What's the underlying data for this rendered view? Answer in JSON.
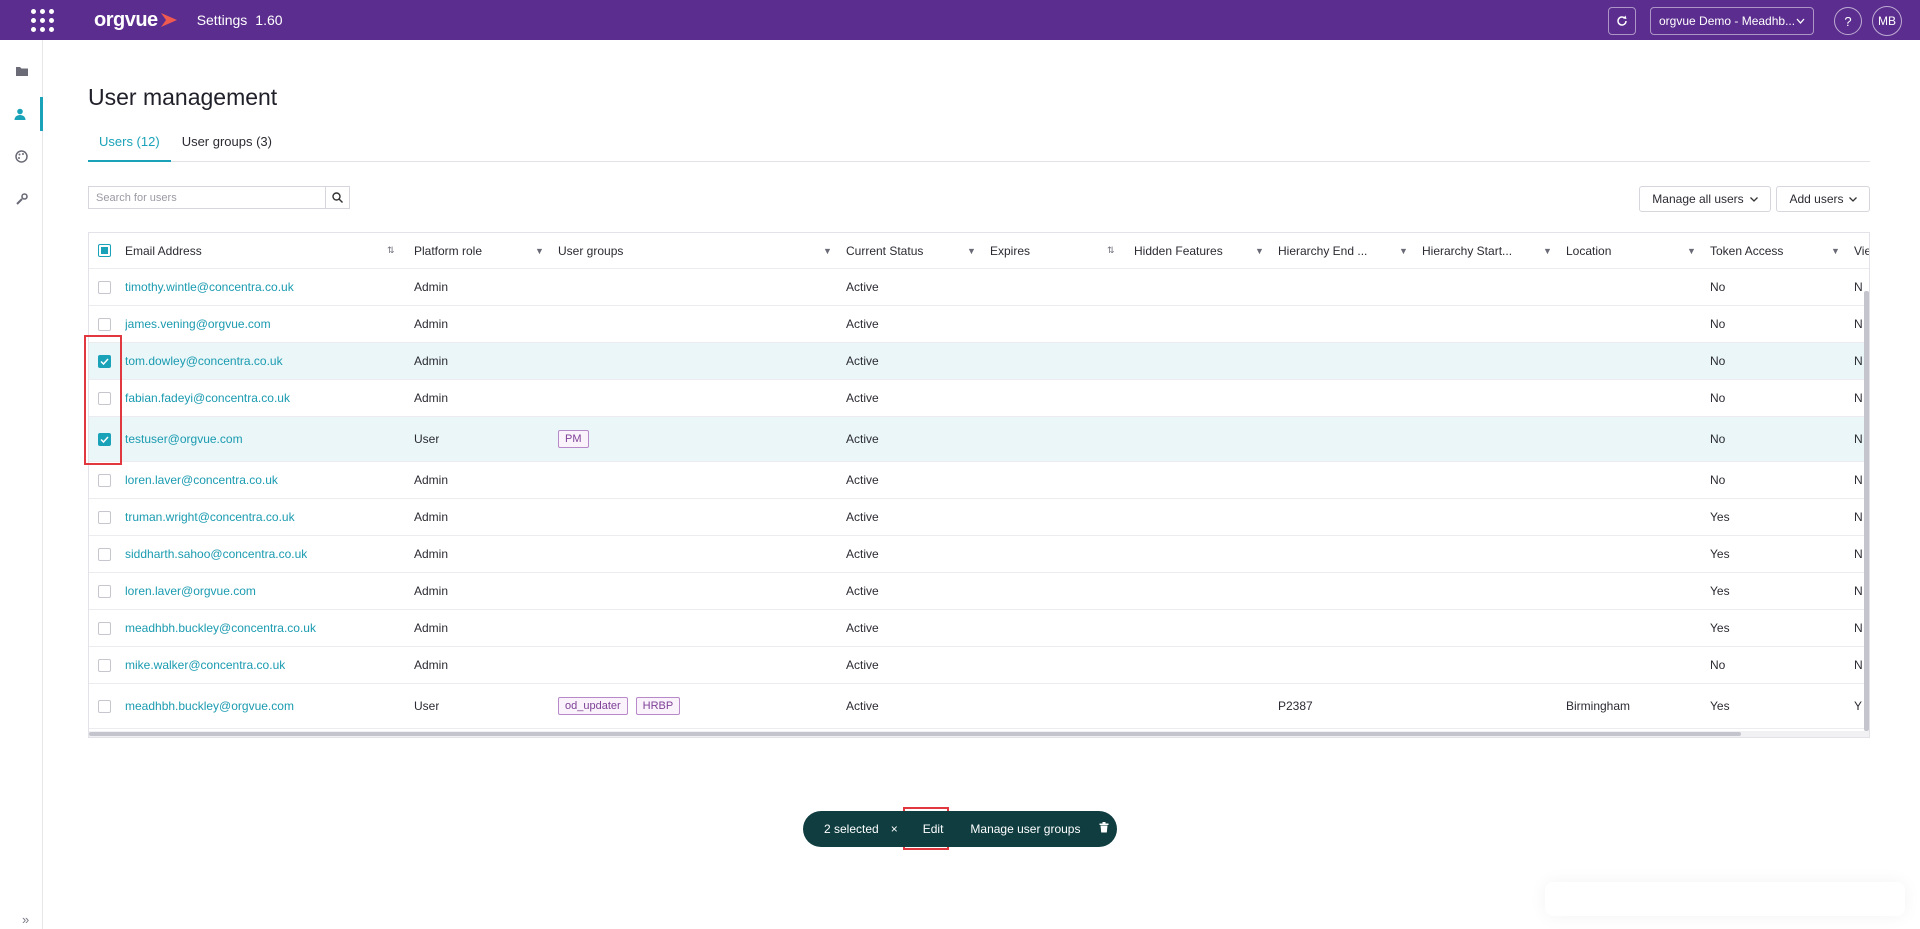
{
  "header": {
    "logo_text": "orgvue",
    "app_title": "Settings",
    "app_version": "1.60",
    "org_select": "orgvue Demo - Meadhb...",
    "help_label": "?",
    "avatar_initials": "MB",
    "brand_color": "#5b2d8e",
    "logo_accent": "#f05a4f"
  },
  "sidebar": {
    "items": [
      {
        "icon": "folder-icon"
      },
      {
        "icon": "user-icon",
        "active": true
      },
      {
        "icon": "palette-icon"
      },
      {
        "icon": "wrench-icon"
      }
    ],
    "expand_label": "»"
  },
  "page": {
    "title": "User management",
    "tabs": [
      {
        "label": "Users (12)",
        "active": true
      },
      {
        "label": "User groups (3)",
        "active": false
      }
    ],
    "search": {
      "placeholder": "Search for users",
      "value": ""
    },
    "manage_all_label": "Manage all users",
    "add_users_label": "Add users"
  },
  "table": {
    "columns": [
      "Email Address",
      "Platform role",
      "User groups",
      "Current Status",
      "Expires",
      "Hidden Features",
      "Hierarchy End ...",
      "Hierarchy Start...",
      "Location",
      "Token Access",
      "Vie"
    ],
    "rows": [
      {
        "email": "timothy.wintle@concentra.co.uk",
        "role": "Admin",
        "groups": [],
        "status": "Active",
        "hier_end": "",
        "location": "",
        "token": "No",
        "view": "N",
        "selected": false
      },
      {
        "email": "james.vening@orgvue.com",
        "role": "Admin",
        "groups": [],
        "status": "Active",
        "hier_end": "",
        "location": "",
        "token": "No",
        "view": "N",
        "selected": false
      },
      {
        "email": "tom.dowley@concentra.co.uk",
        "role": "Admin",
        "groups": [],
        "status": "Active",
        "hier_end": "",
        "location": "",
        "token": "No",
        "view": "N",
        "selected": true
      },
      {
        "email": "fabian.fadeyi@concentra.co.uk",
        "role": "Admin",
        "groups": [],
        "status": "Active",
        "hier_end": "",
        "location": "",
        "token": "No",
        "view": "N",
        "selected": false
      },
      {
        "email": "testuser@orgvue.com",
        "role": "User",
        "groups": [
          "PM"
        ],
        "status": "Active",
        "hier_end": "",
        "location": "",
        "token": "No",
        "view": "N",
        "selected": true
      },
      {
        "email": "loren.laver@concentra.co.uk",
        "role": "Admin",
        "groups": [],
        "status": "Active",
        "hier_end": "",
        "location": "",
        "token": "No",
        "view": "N",
        "selected": false
      },
      {
        "email": "truman.wright@concentra.co.uk",
        "role": "Admin",
        "groups": [],
        "status": "Active",
        "hier_end": "",
        "location": "",
        "token": "Yes",
        "view": "N",
        "selected": false
      },
      {
        "email": "siddharth.sahoo@concentra.co.uk",
        "role": "Admin",
        "groups": [],
        "status": "Active",
        "hier_end": "",
        "location": "",
        "token": "Yes",
        "view": "N",
        "selected": false
      },
      {
        "email": "loren.laver@orgvue.com",
        "role": "Admin",
        "groups": [],
        "status": "Active",
        "hier_end": "",
        "location": "",
        "token": "Yes",
        "view": "N",
        "selected": false
      },
      {
        "email": "meadhbh.buckley@concentra.co.uk",
        "role": "Admin",
        "groups": [],
        "status": "Active",
        "hier_end": "",
        "location": "",
        "token": "Yes",
        "view": "N",
        "selected": false
      },
      {
        "email": "mike.walker@concentra.co.uk",
        "role": "Admin",
        "groups": [],
        "status": "Active",
        "hier_end": "",
        "location": "",
        "token": "No",
        "view": "N",
        "selected": false
      },
      {
        "email": "meadhbh.buckley@orgvue.com",
        "role": "User",
        "groups": [
          "od_updater",
          "HRBP"
        ],
        "status": "Active",
        "hier_end": "P2387",
        "location": "Birmingham",
        "token": "Yes",
        "view": "Y",
        "selected": false
      }
    ]
  },
  "action_bar": {
    "count_label": "2 selected",
    "clear_label": "×",
    "edit_label": "Edit",
    "manage_groups_label": "Manage user groups",
    "delete_icon": "trash-icon"
  },
  "colors": {
    "accent": "#1aa3b8",
    "highlight": "#e0383e",
    "action_bar": "#0f3d40",
    "tag": "#7e3f96"
  }
}
